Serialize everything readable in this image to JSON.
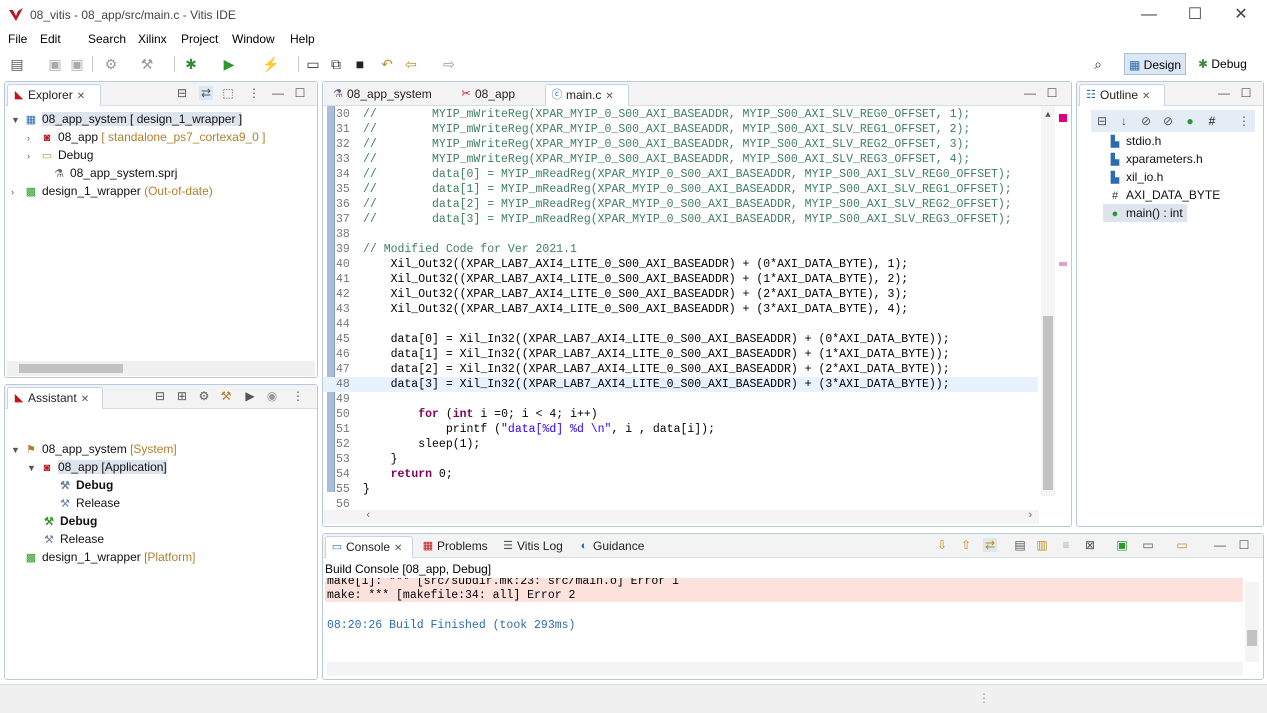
{
  "window": {
    "title": "08_vitis - 08_app/src/main.c - Vitis IDE",
    "minimize": "—",
    "maximize": "☐",
    "close": "✕"
  },
  "menu": [
    "File",
    "Edit",
    "Search",
    "Xilinx",
    "Project",
    "Window",
    "Help"
  ],
  "perspectives": {
    "design": "Design",
    "debug": "Debug"
  },
  "explorer": {
    "tab": "Explorer",
    "items": [
      {
        "label": "08_app_system [ design_1_wrapper ]",
        "extra": ""
      },
      {
        "label": "08_app",
        "extra": "[ standalone_ps7_cortexa9_0 ]"
      },
      {
        "label": "Debug",
        "extra": ""
      },
      {
        "label": "08_app_system.sprj",
        "extra": ""
      },
      {
        "label": "design_1_wrapper",
        "extra": "(Out-of-date)"
      }
    ]
  },
  "assistant": {
    "tab": "Assistant",
    "items": [
      {
        "label": "08_app_system",
        "extra": "[System]"
      },
      {
        "label": "08_app [Application]",
        "extra": ""
      },
      {
        "label": "Debug",
        "extra": ""
      },
      {
        "label": "Release",
        "extra": ""
      },
      {
        "label": "Debug",
        "extra": ""
      },
      {
        "label": "Release",
        "extra": ""
      },
      {
        "label": "design_1_wrapper",
        "extra": "[Platform]"
      }
    ]
  },
  "editor": {
    "tabs": [
      "08_app_system",
      "08_app",
      "main.c"
    ],
    "lines": [
      {
        "n": "30",
        "t": "//        MYIP_mWriteReg(XPAR_MYIP_0_S00_AXI_BASEADDR, MYIP_S00_AXI_SLV_REG0_OFFSET, 1);"
      },
      {
        "n": "31",
        "t": "//        MYIP_mWriteReg(XPAR_MYIP_0_S00_AXI_BASEADDR, MYIP_S00_AXI_SLV_REG1_OFFSET, 2);"
      },
      {
        "n": "32",
        "t": "//        MYIP_mWriteReg(XPAR_MYIP_0_S00_AXI_BASEADDR, MYIP_S00_AXI_SLV_REG2_OFFSET, 3);"
      },
      {
        "n": "33",
        "t": "//        MYIP_mWriteReg(XPAR_MYIP_0_S00_AXI_BASEADDR, MYIP_S00_AXI_SLV_REG3_OFFSET, 4);"
      },
      {
        "n": "34",
        "t": "//        data[0] = MYIP_mReadReg(XPAR_MYIP_0_S00_AXI_BASEADDR, MYIP_S00_AXI_SLV_REG0_OFFSET);"
      },
      {
        "n": "35",
        "t": "//        data[1] = MYIP_mReadReg(XPAR_MYIP_0_S00_AXI_BASEADDR, MYIP_S00_AXI_SLV_REG1_OFFSET);"
      },
      {
        "n": "36",
        "t": "//        data[2] = MYIP_mReadReg(XPAR_MYIP_0_S00_AXI_BASEADDR, MYIP_S00_AXI_SLV_REG2_OFFSET);"
      },
      {
        "n": "37",
        "t": "//        data[3] = MYIP_mReadReg(XPAR_MYIP_0_S00_AXI_BASEADDR, MYIP_S00_AXI_SLV_REG3_OFFSET);"
      },
      {
        "n": "38",
        "t": ""
      },
      {
        "n": "39",
        "t": "// Modified Code for Ver 2021.1"
      },
      {
        "n": "40",
        "t": "    Xil_Out32((XPAR_LAB7_AXI4_LITE_0_S00_AXI_BASEADDR) + (0*AXI_DATA_BYTE), 1);"
      },
      {
        "n": "41",
        "t": "    Xil_Out32((XPAR_LAB7_AXI4_LITE_0_S00_AXI_BASEADDR) + (1*AXI_DATA_BYTE), 2);"
      },
      {
        "n": "42",
        "t": "    Xil_Out32((XPAR_LAB7_AXI4_LITE_0_S00_AXI_BASEADDR) + (2*AXI_DATA_BYTE), 3);"
      },
      {
        "n": "43",
        "t": "    Xil_Out32((XPAR_LAB7_AXI4_LITE_0_S00_AXI_BASEADDR) + (3*AXI_DATA_BYTE), 4);"
      },
      {
        "n": "44",
        "t": ""
      },
      {
        "n": "45",
        "t": "    data[0] = Xil_In32((XPAR_LAB7_AXI4_LITE_0_S00_AXI_BASEADDR) + (0*AXI_DATA_BYTE));"
      },
      {
        "n": "46",
        "t": "    data[1] = Xil_In32((XPAR_LAB7_AXI4_LITE_0_S00_AXI_BASEADDR) + (1*AXI_DATA_BYTE));"
      },
      {
        "n": "47",
        "t": "    data[2] = Xil_In32((XPAR_LAB7_AXI4_LITE_0_S00_AXI_BASEADDR) + (2*AXI_DATA_BYTE));"
      },
      {
        "n": "48",
        "t": "    data[3] = Xil_In32((XPAR_LAB7_AXI4_LITE_0_S00_AXI_BASEADDR) + (3*AXI_DATA_BYTE));"
      },
      {
        "n": "49",
        "t": ""
      },
      {
        "n": "50",
        "t": "        for (int i =0; i < 4; i++)"
      },
      {
        "n": "51",
        "t": "            printf (\"data[%d] %d \\n\", i , data[i]);"
      },
      {
        "n": "52",
        "t": "        sleep(1);"
      },
      {
        "n": "53",
        "t": "    }"
      },
      {
        "n": "54",
        "t": "    return 0;"
      },
      {
        "n": "55",
        "t": "}"
      },
      {
        "n": "56",
        "t": ""
      }
    ]
  },
  "outline": {
    "tab": "Outline",
    "items": [
      "stdio.h",
      "xparameters.h",
      "xil_io.h",
      "AXI_DATA_BYTE",
      "main() : int"
    ]
  },
  "console": {
    "tabs": [
      "Console",
      "Problems",
      "Vitis Log",
      "Guidance"
    ],
    "header": "Build Console [08_app, Debug]",
    "lines": [
      "make[1]: *** [src/subdir.mk:23: src/main.o] Error 1",
      "make: *** [makefile:34: all] Error 2",
      "",
      "08:20:26 Build Finished (took 293ms)"
    ]
  },
  "colors": {
    "accent": "#2b6cb0",
    "error_bg": "#fde1dd",
    "panel_border": "#b9c9dd"
  }
}
